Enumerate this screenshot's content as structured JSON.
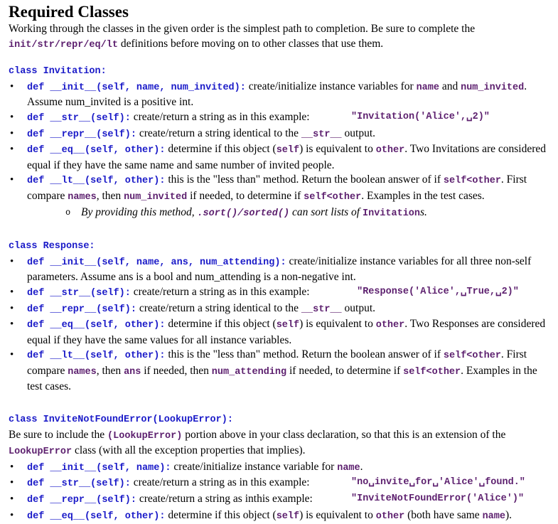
{
  "title": "Required Classes",
  "intro": [
    {
      "s": "t",
      "t": "Working through the classes in the given order is the simplest path to completion. Be sure to complete the "
    },
    {
      "s": "p",
      "t": "init/str/repr/eq/lt"
    },
    {
      "s": "t",
      "t": " definitions before moving on to other classes that use them."
    }
  ],
  "sections": [
    {
      "heading": "class Invitation:",
      "note": null,
      "items": [
        {
          "kind": "b",
          "segs": [
            {
              "s": "c",
              "t": "def __init__(self, name, num_invited):"
            },
            {
              "s": "t",
              "t": " create/initialize instance variables for "
            },
            {
              "s": "p",
              "t": "name"
            },
            {
              "s": "t",
              "t": " and "
            },
            {
              "s": "p",
              "t": "num_invited"
            },
            {
              "s": "t",
              "t": ". Assume num_invited is a positive int."
            }
          ]
        },
        {
          "kind": "b",
          "segs": [
            {
              "s": "c",
              "t": "def __str__(self):"
            },
            {
              "s": "t",
              "t": " create/return a string as in this example:"
            },
            {
              "s": "ex",
              "t": "\"Invitation('Alice',␣2)\""
            }
          ]
        },
        {
          "kind": "b",
          "segs": [
            {
              "s": "c",
              "t": "def __repr__(self):"
            },
            {
              "s": "t",
              "t": " create/return a string identical to the "
            },
            {
              "s": "p",
              "t": "__str__"
            },
            {
              "s": "t",
              "t": " output."
            }
          ]
        },
        {
          "kind": "b",
          "segs": [
            {
              "s": "c",
              "t": "def __eq__(self, other):"
            },
            {
              "s": "t",
              "t": " determine if this object ("
            },
            {
              "s": "p",
              "t": "self"
            },
            {
              "s": "t",
              "t": ") is equivalent to "
            },
            {
              "s": "p",
              "t": "other"
            },
            {
              "s": "t",
              "t": ". Two Invitations are considered equal if they have the same name and same number of invited people."
            }
          ]
        },
        {
          "kind": "b",
          "segs": [
            {
              "s": "c",
              "t": "def __lt__(self, other):"
            },
            {
              "s": "t",
              "t": " this is the \"less than\" method. Return the boolean answer of if "
            },
            {
              "s": "p",
              "t": "self<other"
            },
            {
              "s": "t",
              "t": ". First compare "
            },
            {
              "s": "p",
              "t": "names"
            },
            {
              "s": "t",
              "t": ", then "
            },
            {
              "s": "p",
              "t": "num_invited"
            },
            {
              "s": "t",
              "t": " if needed, to determine if "
            },
            {
              "s": "p",
              "t": "self<other"
            },
            {
              "s": "t",
              "t": ". Examples in the test cases."
            }
          ]
        },
        {
          "kind": "sub",
          "segs": [
            {
              "s": "i",
              "t": "By providing this method, "
            },
            {
              "s": "pi",
              "t": ".sort()/sorted()"
            },
            {
              "s": "i",
              "t": " can sort lists of "
            },
            {
              "s": "p",
              "t": "Invitation"
            },
            {
              "s": "i",
              "t": "s."
            }
          ]
        }
      ]
    },
    {
      "heading": "class Response:",
      "note": null,
      "items": [
        {
          "kind": "b",
          "segs": [
            {
              "s": "c",
              "t": "def __init__(self, name, ans, num_attending):"
            },
            {
              "s": "t",
              "t": " create/initialize instance variables for all three non-self parameters. Assume ans is a bool and num_attending is a non-negative int."
            }
          ]
        },
        {
          "kind": "b",
          "segs": [
            {
              "s": "c",
              "t": "def __str__(self):"
            },
            {
              "s": "t",
              "t": " create/return a string as in this example:"
            },
            {
              "s": "ex",
              "t": " \"Response('Alice',␣True,␣2)\""
            }
          ]
        },
        {
          "kind": "b",
          "segs": [
            {
              "s": "c",
              "t": "def __repr__(self):"
            },
            {
              "s": "t",
              "t": " create/return a string identical to the "
            },
            {
              "s": "p",
              "t": "__str__"
            },
            {
              "s": "t",
              "t": " output."
            }
          ]
        },
        {
          "kind": "b",
          "segs": [
            {
              "s": "c",
              "t": "def __eq__(self, other):"
            },
            {
              "s": "t",
              "t": " determine if this object ("
            },
            {
              "s": "p",
              "t": "self"
            },
            {
              "s": "t",
              "t": ") is equivalent to "
            },
            {
              "s": "p",
              "t": "other"
            },
            {
              "s": "t",
              "t": ". Two Responses are considered equal if they have the same values for all instance variables."
            }
          ]
        },
        {
          "kind": "b",
          "segs": [
            {
              "s": "c",
              "t": "def __lt__(self, other):"
            },
            {
              "s": "t",
              "t": " this is the \"less than\" method. Return the boolean answer of if "
            },
            {
              "s": "p",
              "t": "self<other"
            },
            {
              "s": "t",
              "t": ". First compare "
            },
            {
              "s": "p",
              "t": "names"
            },
            {
              "s": "t",
              "t": ", then "
            },
            {
              "s": "p",
              "t": "ans"
            },
            {
              "s": "t",
              "t": " if needed, then "
            },
            {
              "s": "p",
              "t": "num_attending"
            },
            {
              "s": "t",
              "t": " if needed, to determine if "
            },
            {
              "s": "p",
              "t": "self<other"
            },
            {
              "s": "t",
              "t": ". Examples in the test cases."
            }
          ]
        }
      ]
    },
    {
      "heading": "class InviteNotFoundError(LookupError):",
      "note": [
        {
          "s": "t",
          "t": "Be sure to include the "
        },
        {
          "s": "p",
          "t": "(LookupError)"
        },
        {
          "s": "t",
          "t": " portion above in  your class declaration, so that this is an extension of the "
        },
        {
          "s": "p",
          "t": "LookupError"
        },
        {
          "s": "t",
          "t": " class (with all the exception properties that implies)."
        }
      ],
      "items": [
        {
          "kind": "b",
          "segs": [
            {
              "s": "c",
              "t": "def __init__(self, name):"
            },
            {
              "s": "t",
              "t": " create/initialize instance variable for "
            },
            {
              "s": "p",
              "t": "name"
            },
            {
              "s": "t",
              "t": "."
            }
          ]
        },
        {
          "kind": "b",
          "segs": [
            {
              "s": "c",
              "t": "def __str__(self):"
            },
            {
              "s": "t",
              "t": " create/return a string as in this example:"
            },
            {
              "s": "ex",
              "t": "\"no␣invite␣for␣'Alice'␣found.\""
            }
          ]
        },
        {
          "kind": "b",
          "segs": [
            {
              "s": "c",
              "t": "def __repr__(self):"
            },
            {
              "s": "t",
              "t": " create/return a string as inthis example:"
            },
            {
              "s": "ex",
              "t": "\"InviteNotFoundError('Alice')\""
            }
          ]
        },
        {
          "kind": "b",
          "segs": [
            {
              "s": "c",
              "t": "def __eq__(self, other):"
            },
            {
              "s": "t",
              "t": " determine if this object ("
            },
            {
              "s": "p",
              "t": "self"
            },
            {
              "s": "t",
              "t": ") is equivalent to "
            },
            {
              "s": "p",
              "t": "other"
            },
            {
              "s": "t",
              "t": " (both have same "
            },
            {
              "s": "p",
              "t": "name"
            },
            {
              "s": "t",
              "t": ")."
            }
          ]
        }
      ]
    }
  ]
}
